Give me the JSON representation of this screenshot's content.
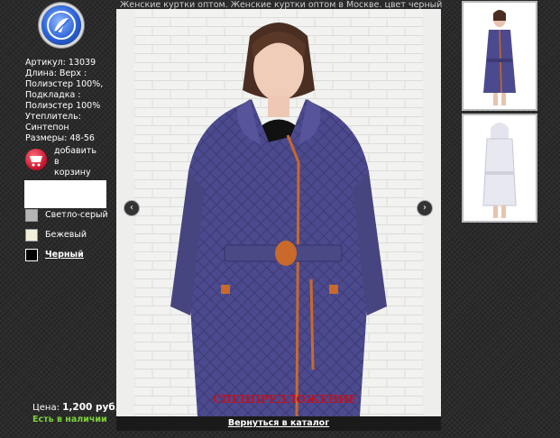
{
  "page_title": "Женские куртки оптом. Женские куртки оптом в Москве. цвет черный",
  "logo_icon": "brand-logo-icon",
  "product": {
    "article": "Артикул: 13039",
    "length": "Длина: Верх :",
    "material_top": "Полиэстер 100%,",
    "lining_label": "Подкладка :",
    "material_lining": "Полиэстер 100%",
    "insulation_label": "Утеплитель:",
    "insulation": "Синтепон",
    "sizes": "Размеры: 48-56"
  },
  "cart": {
    "label_line1": "добавить",
    "label_line2": "в",
    "label_line3": "корзину",
    "icon": "cart-icon",
    "icon_color": "#d3142e"
  },
  "colors": [
    {
      "label": "Светло-серый",
      "hex": "#b5b5b5",
      "selected": false
    },
    {
      "label": "Бежевый",
      "hex": "#f3f0d9",
      "selected": false
    },
    {
      "label": "Черный",
      "hex": "#000000",
      "selected": true
    }
  ],
  "price_label": "Цена:",
  "price_value": "1,200 руб.",
  "stock": "Есть в наличии",
  "stock_color": "#7bd23a",
  "offer_stamp": "СПЕЦПРЕДЛОЖЕНИЕ",
  "back_link": "Вернуться в каталог",
  "nav": {
    "prev_icon": "chevron-left-icon",
    "next_icon": "chevron-right-icon"
  },
  "jacket_color": "#4c4a8e",
  "accent_color": "#c9692a"
}
